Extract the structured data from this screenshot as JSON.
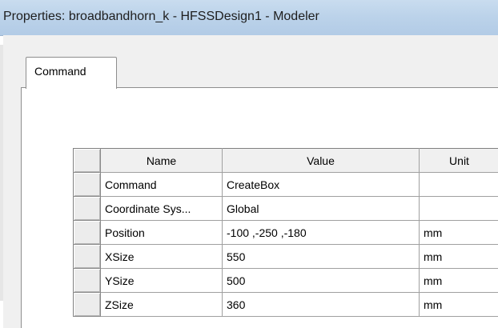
{
  "window": {
    "title": "Properties: broadbandhorn_k - HFSSDesign1 - Modeler"
  },
  "tabs": [
    {
      "label": "Command",
      "selected": true
    }
  ],
  "table": {
    "columns": [
      "Name",
      "Value",
      "Unit"
    ],
    "rows": [
      {
        "name": "Command",
        "value": "CreateBox",
        "unit": ""
      },
      {
        "name": "Coordinate Sys...",
        "value": "Global",
        "unit": ""
      },
      {
        "name": "Position",
        "value": "-100 ,-250 ,-180",
        "unit": "mm"
      },
      {
        "name": "XSize",
        "value": "550",
        "unit": "mm"
      },
      {
        "name": "YSize",
        "value": "500",
        "unit": "mm"
      },
      {
        "name": "ZSize",
        "value": "360",
        "unit": "mm"
      }
    ]
  },
  "colors": {
    "titlebar": "#bcd3ea",
    "dialog_background": "#f0f0f0",
    "grid_lines": "#a0a0a0"
  }
}
